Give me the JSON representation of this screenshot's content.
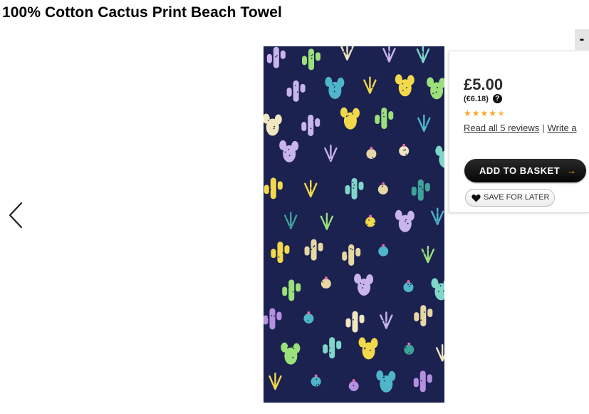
{
  "product": {
    "title": "100% Cotton Cactus Print Beach Towel"
  },
  "gallery": {
    "image_alt": "Cactus print beach towel",
    "prev_icon": "chevron-left-icon"
  },
  "panel": {
    "collapse_label": "-",
    "price": "£5.00",
    "alt_price": "(€6.18)",
    "help_icon_glyph": "?",
    "rating_stars": 4.5,
    "rating_glyphs": [
      "★",
      "★",
      "★",
      "★",
      "★"
    ],
    "read_reviews": "Read all 5 reviews",
    "separator": "|",
    "write_review": "Write a",
    "add_to_basket": "ADD TO BASKET",
    "add_arrow": "→",
    "save_for_later": "SAVE FOR LATER",
    "save_icon": "heart-icon"
  },
  "colors": {
    "star": "#f5a623",
    "basket_button": "#111111",
    "basket_arrow": "#f2c300",
    "towel_background": "#1b2250"
  }
}
